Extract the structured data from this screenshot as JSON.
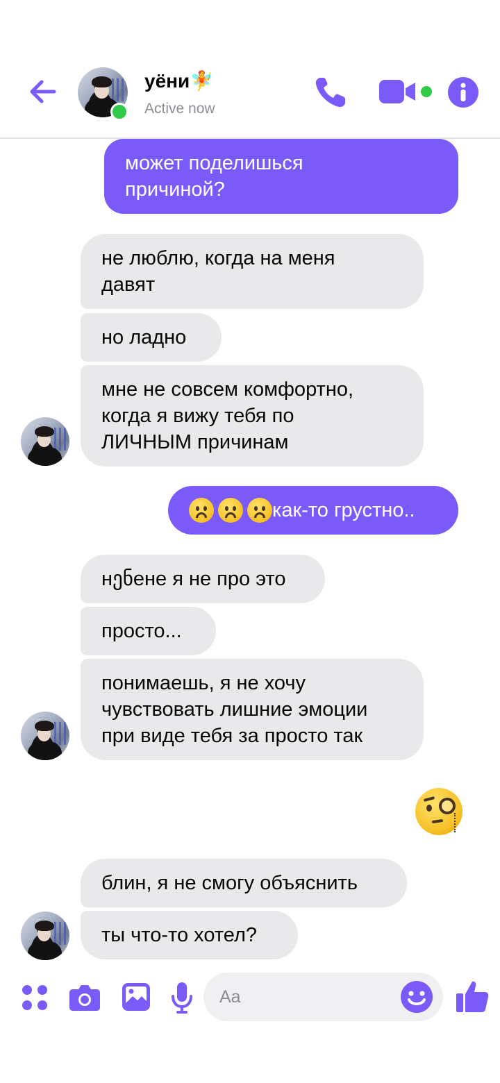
{
  "header": {
    "contact_name": "уёни🧚",
    "status": "Active now",
    "icons": [
      "back-arrow-icon",
      "phone-icon",
      "video-camera-icon",
      "info-icon"
    ]
  },
  "messages": [
    {
      "direction": "outgoing",
      "text": "может поделишься\nпричиной?"
    },
    {
      "direction": "incoming",
      "text": "не люблю, когда на меня\nдавят"
    },
    {
      "direction": "incoming",
      "text": "но ладно"
    },
    {
      "direction": "incoming",
      "text": "мне не совсем комфортно,\nкогда я вижу тебя по\nЛИЧНЫМ причинам"
    },
    {
      "direction": "outgoing",
      "text": "как-то грустно..",
      "emoji_prefix": "☹️☹️☹️"
    },
    {
      "direction": "incoming",
      "text": "нენене я не про это"
    },
    {
      "direction": "incoming",
      "text": "просто..."
    },
    {
      "direction": "incoming",
      "text": "понимаешь, я не хочу\nчувствовать лишние эмоции\nпри виде тебя за просто так"
    },
    {
      "direction": "outgoing",
      "emoji": "🧐"
    },
    {
      "direction": "incoming",
      "text": "блин, я не смогу объяснить"
    },
    {
      "direction": "incoming",
      "text": "ты что-то хотел?"
    }
  ],
  "composer": {
    "placeholder": "Aa",
    "icons": [
      "apps-icon",
      "camera-icon",
      "gallery-icon",
      "microphone-icon",
      "emoji-icon",
      "thumbs-up-icon"
    ]
  },
  "colors": {
    "accent": "#7a5af8",
    "incoming_bubble": "#e9e9eb",
    "online": "#31c94a"
  }
}
